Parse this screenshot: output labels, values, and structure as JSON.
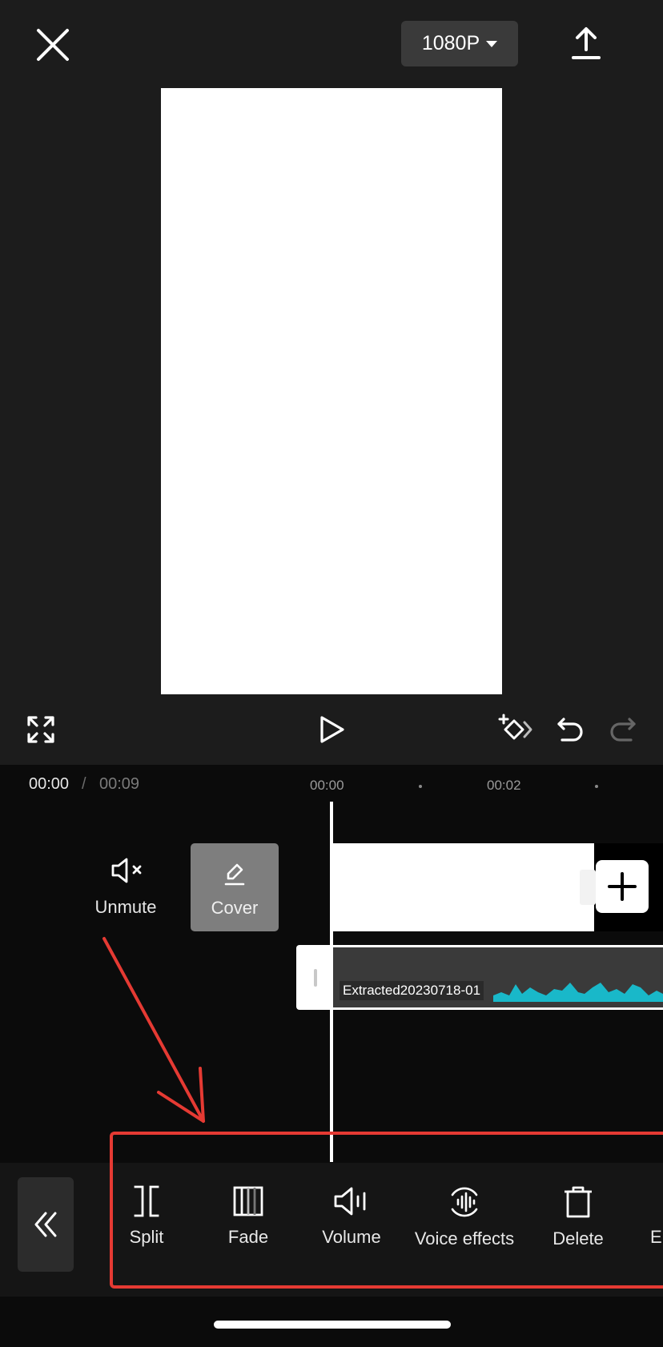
{
  "header": {
    "quality_label": "1080P"
  },
  "timeline": {
    "current_time": "00:00",
    "separator": "/",
    "total_time": "00:09",
    "ruler": [
      "00:00",
      "00:02"
    ]
  },
  "tracks": {
    "unmute_label": "Unmute",
    "cover_label": "Cover",
    "audio_clip_label": "Extracted20230718-01"
  },
  "toolbar": {
    "items": [
      {
        "label": "Split",
        "icon": "split-icon"
      },
      {
        "label": "Fade",
        "icon": "fade-icon"
      },
      {
        "label": "Volume",
        "icon": "volume-icon"
      },
      {
        "label": "Voice effects",
        "icon": "voice-effects-icon"
      },
      {
        "label": "Delete",
        "icon": "delete-icon"
      },
      {
        "label": "E",
        "icon": "more-tool-icon"
      }
    ]
  },
  "colors": {
    "accent_waveform": "#19b8c9",
    "annotation": "#e53a33",
    "panel_bg": "#1c1c1c"
  }
}
